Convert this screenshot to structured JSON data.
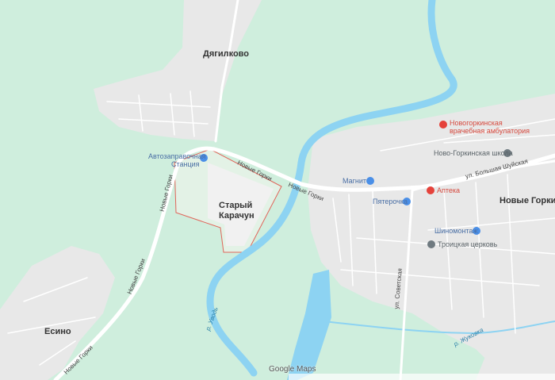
{
  "places": {
    "dyagilkovo": "Дягилково",
    "stary_karachun_1": "Старый",
    "stary_karachun_2": "Карачун",
    "novye_gorki": "Новые Горки",
    "esino": "Есино"
  },
  "pois": {
    "gas_station_1": "Автозаправочная",
    "gas_station_2": "Станция",
    "clinic_1": "Новогоркинская",
    "clinic_2": "врачебная амбулатория",
    "school": "Ново-Горкинская школа",
    "magnit": "Магнит",
    "pharmacy": "Аптека",
    "pyaterochka": "Пятерочка",
    "tire_service": "Шиномонтаж",
    "church": "Троицкая церковь"
  },
  "roads": {
    "novye_gorki_a": "Новые Горки",
    "novye_gorki_b": "Новые Горки",
    "novye_gorki_c": "Новые Горки",
    "novye_gorki_d": "Новые Горки",
    "novye_gorki_e": "Новые Горки",
    "bolshaya_shuyskaya": "ул. Большая Шуйская",
    "sovetskaya": "ул. Советская"
  },
  "rivers": {
    "uvod": "р. Уводь",
    "zhukovka": "р. Жуковка"
  },
  "logo": {
    "google": "Google",
    "maps": "Maps"
  },
  "colors": {
    "forest": "#cfeedd",
    "urban": "#e8e8e8",
    "water": "#8dd3f2",
    "road": "#ffffff",
    "boundary": "#e0655a",
    "poi_blue": "#4a8fe7",
    "poi_red": "#e5423b",
    "poi_gray": "#6f7a80"
  }
}
